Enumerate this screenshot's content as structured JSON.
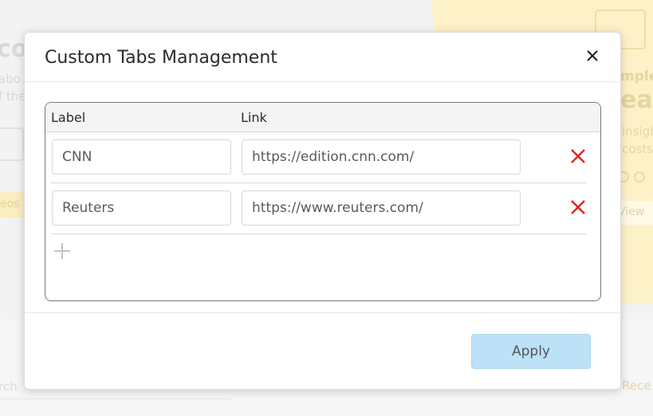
{
  "background": {
    "left_big": "cor",
    "left_line1": "abo",
    "left_line2": "f the",
    "left_btn": "eos",
    "right_sample": "mple",
    "right_big": "eal",
    "right_line1": "insigh",
    "right_line2": "costs",
    "right_view": "View",
    "search_hint": "rch",
    "recent": "Rece"
  },
  "modal": {
    "title": "Custom Tabs Management",
    "close_icon": "close-icon",
    "columns": {
      "label": "Label",
      "link": "Link"
    },
    "rows": [
      {
        "label": "CNN",
        "link": "https://edition.cnn.com/"
      },
      {
        "label": "Reuters",
        "link": "https://www.reuters.com/"
      }
    ],
    "add_icon": "plus-icon",
    "delete_icon": "x-icon",
    "apply_label": "Apply"
  },
  "colors": {
    "delete": "#e52020",
    "apply_bg": "#bde1f7",
    "bg_yellow": "#fdf1c8"
  }
}
